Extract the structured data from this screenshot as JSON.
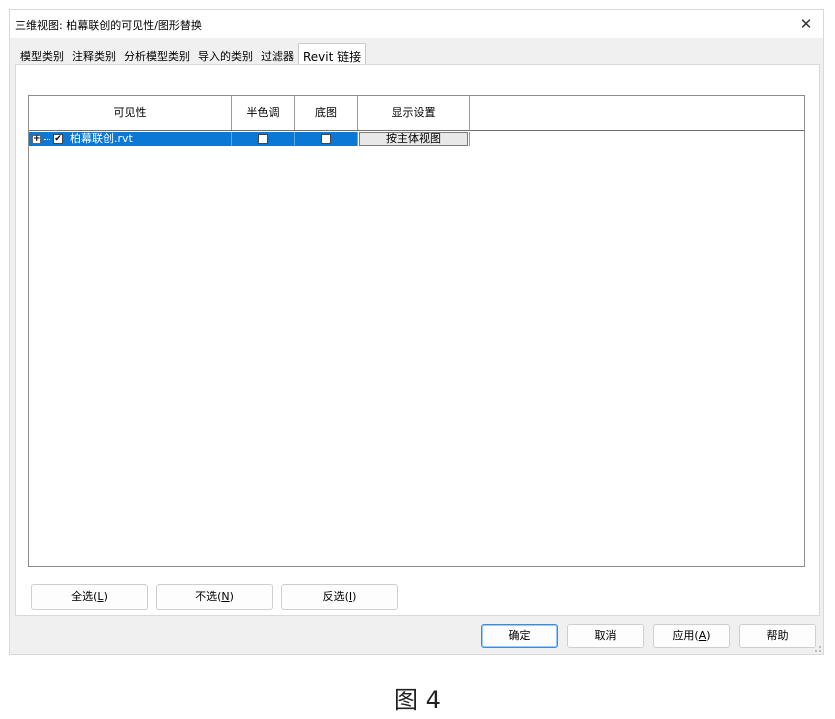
{
  "window": {
    "title": "三维视图: 柏幕联创的可见性/图形替换",
    "close_glyph": "✕"
  },
  "tabs": [
    {
      "label": "模型类别",
      "active": false
    },
    {
      "label": "注释类别",
      "active": false
    },
    {
      "label": "分析模型类别",
      "active": false
    },
    {
      "label": "导入的类别",
      "active": false
    },
    {
      "label": "过滤器",
      "active": false
    },
    {
      "label": "Revit 链接",
      "active": true
    }
  ],
  "grid": {
    "columns": [
      "可见性",
      "半色调",
      "底图",
      "显示设置"
    ],
    "rows": [
      {
        "expand_glyph": "+",
        "visible_checked": true,
        "name": "柏幕联创.rvt",
        "halftone_checked": false,
        "underlay_checked": false,
        "display_setting": "按主体视图",
        "selected": true
      }
    ]
  },
  "selection_buttons": {
    "select_all": {
      "text": "全选(",
      "key": "L",
      "end": ")"
    },
    "select_none": {
      "text": "不选(",
      "key": "N",
      "end": ")"
    },
    "invert": {
      "text": "反选(",
      "key": "I",
      "end": ")"
    }
  },
  "footer": {
    "ok": "确定",
    "cancel": "取消",
    "apply": {
      "text": "应用(",
      "key": "A",
      "end": ")"
    },
    "help": "帮助"
  },
  "caption": "图 4",
  "colors": {
    "selection": "#0a78d4",
    "dialog_bg": "#f0f0f0",
    "default_button_border": "#3c8cd8"
  }
}
